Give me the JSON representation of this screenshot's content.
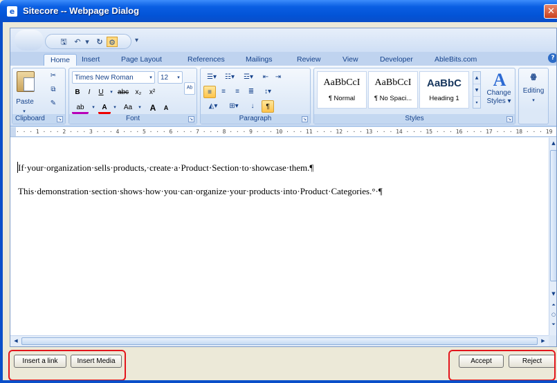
{
  "window": {
    "title": "Sitecore -- Webpage Dialog",
    "close_glyph": "✕",
    "icon": "ie-page-icon"
  },
  "qat": {
    "icons": [
      "save-icon",
      "undo-icon",
      "redo-icon",
      "customize-icon"
    ],
    "dropdown_glyph": "▾"
  },
  "ribbon": {
    "tabs": [
      "Home",
      "Insert",
      "Page Layout",
      "References",
      "Mailings",
      "Review",
      "View",
      "Developer",
      "AbleBits.com"
    ],
    "active_tab": "Home",
    "help_glyph": "?",
    "clipboard": {
      "label": "Clipboard",
      "paste": "Paste"
    },
    "font": {
      "label": "Font",
      "family": "Times New Roman",
      "size": "12",
      "bold": "B",
      "italic": "I",
      "underline": "U",
      "strike": "abc",
      "subscript": "x₂",
      "superscript": "x²",
      "grow": "A",
      "shrink": "A",
      "case": "Aa"
    },
    "paragraph": {
      "label": "Paragraph",
      "pilcrow": "¶"
    },
    "styles": {
      "label": "Styles",
      "items": [
        {
          "sample": "AaBbCcI",
          "name": "¶ Normal"
        },
        {
          "sample": "AaBbCcI",
          "name": "¶ No Spaci..."
        },
        {
          "sample": "AaBbC",
          "name": "Heading 1"
        }
      ],
      "change_styles_line1": "Change",
      "change_styles_line2": "Styles ▾"
    },
    "editing": {
      "label": "Editing"
    }
  },
  "ruler": {
    "text": "· · · 1 · · · 2 · · · 3 · · · 4 · · · 5 · · · 6 · · · 7 · · · 8 · · · 9 · · · 10 · · · 11 · · · 12 · · · 13 · · · 14 · · · 15 · · · 16 · · · 17 · · · 18 · · · 19 · ·"
  },
  "document": {
    "paragraphs": [
      "If·your·organization·sells·products,·create·a·Product·Section·to·showcase·them.¶",
      "This·demonstration·section·shows·how·you·can·organize·your·products·into·Product·Categories.°·¶"
    ]
  },
  "footer": {
    "insert_link": "Insert a link",
    "insert_media": "Insert Media",
    "accept": "Accept",
    "reject": "Reject"
  },
  "colors": {
    "titlebar": "#0353d6",
    "annotation_box": "#e3141b",
    "ribbon_text": "#15428b"
  }
}
